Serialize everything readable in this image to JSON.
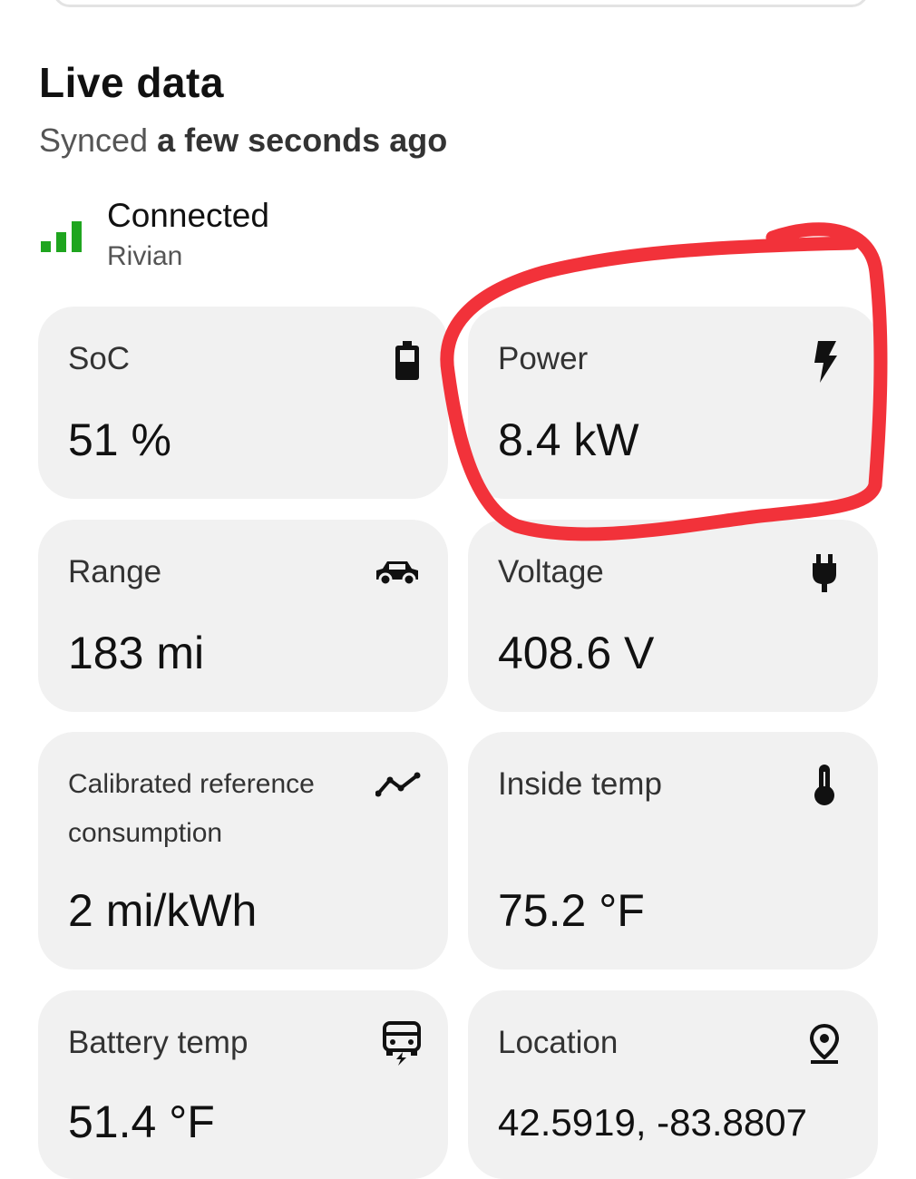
{
  "header": {
    "title": "Live data",
    "synced_prefix": "Synced",
    "synced_time": "a few seconds ago"
  },
  "connection": {
    "status": "Connected",
    "vehicle": "Rivian",
    "signal_icon": "signal-bars-icon",
    "signal_color": "#1fa51f"
  },
  "metrics": [
    {
      "label": "SoC",
      "value": "51 %",
      "icon": "battery-icon"
    },
    {
      "label": "Power",
      "value": "8.4 kW",
      "icon": "lightning-icon"
    },
    {
      "label": "Range",
      "value": "183 mi",
      "icon": "car-icon"
    },
    {
      "label": "Voltage",
      "value": "408.6 V",
      "icon": "plug-icon"
    },
    {
      "label": "Calibrated reference consumption",
      "value": "2 mi/kWh",
      "icon": "trend-line-icon"
    },
    {
      "label": "Inside temp",
      "value": "75.2 °F",
      "icon": "thermometer-icon"
    },
    {
      "label": "Battery temp",
      "value": "51.4 °F",
      "icon": "battery-temp-car-icon"
    },
    {
      "label": "Location",
      "value": "42.5919, -83.8807",
      "icon": "location-pin-icon"
    }
  ],
  "colors": {
    "card_background": "#f1f1f1",
    "highlight_annotation": "#f2323a"
  }
}
